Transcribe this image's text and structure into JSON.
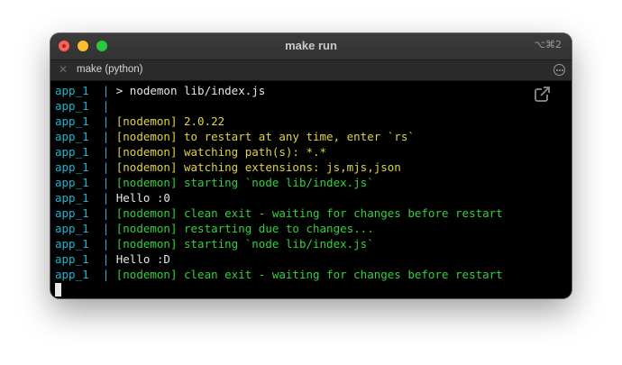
{
  "window": {
    "title": "make run",
    "shortcut": "⌥⌘2"
  },
  "tab": {
    "title": "make (python)",
    "close_icon": "close-icon",
    "options_icon": "more-options-icon"
  },
  "terminal": {
    "lines": [
      {
        "prefix": "app_1",
        "sep": "  | ",
        "text": "> nodemon lib/index.js",
        "color": "white"
      },
      {
        "prefix": "app_1",
        "sep": "  | ",
        "text": "",
        "color": "white"
      },
      {
        "prefix": "app_1",
        "sep": "  | ",
        "text": "[nodemon] 2.0.22",
        "color": "yellow"
      },
      {
        "prefix": "app_1",
        "sep": "  | ",
        "text": "[nodemon] to restart at any time, enter `rs`",
        "color": "yellow"
      },
      {
        "prefix": "app_1",
        "sep": "  | ",
        "text": "[nodemon] watching path(s): *.*",
        "color": "yellow"
      },
      {
        "prefix": "app_1",
        "sep": "  | ",
        "text": "[nodemon] watching extensions: js,mjs,json",
        "color": "yellow"
      },
      {
        "prefix": "app_1",
        "sep": "  | ",
        "text": "[nodemon] starting `node lib/index.js`",
        "color": "green"
      },
      {
        "prefix": "app_1",
        "sep": "  | ",
        "text": "Hello :0",
        "color": "white"
      },
      {
        "prefix": "app_1",
        "sep": "  | ",
        "text": "[nodemon] clean exit - waiting for changes before restart",
        "color": "green"
      },
      {
        "prefix": "app_1",
        "sep": "  | ",
        "text": "[nodemon] restarting due to changes...",
        "color": "green"
      },
      {
        "prefix": "app_1",
        "sep": "  | ",
        "text": "[nodemon] starting `node lib/index.js`",
        "color": "green"
      },
      {
        "prefix": "app_1",
        "sep": "  | ",
        "text": "Hello :D",
        "color": "white"
      },
      {
        "prefix": "app_1",
        "sep": "  | ",
        "text": "[nodemon] clean exit - waiting for changes before restart",
        "color": "green"
      }
    ],
    "popout_icon": "popout-icon"
  },
  "colors": {
    "prefix": "#1bb7d3",
    "white": "#e6e6e6",
    "yellow": "#dfd440",
    "green": "#33d040",
    "background": "#000000"
  }
}
